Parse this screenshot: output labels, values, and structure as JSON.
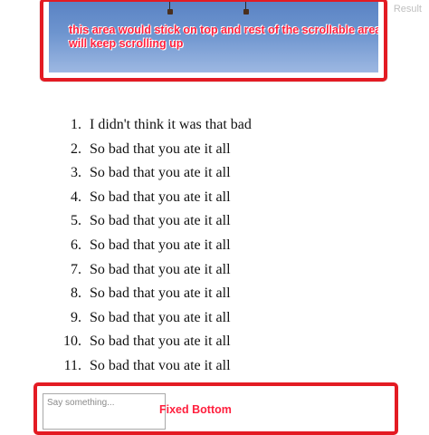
{
  "result_label": "Result",
  "header": {
    "annotation": "this area would stick on top and rest of the scrollable area will keep scrolling up"
  },
  "list": {
    "items": [
      {
        "number": "1.",
        "text": "I didn't think it was that bad"
      },
      {
        "number": "2.",
        "text": "So bad that you ate it all"
      },
      {
        "number": "3.",
        "text": "So bad that you ate it all"
      },
      {
        "number": "4.",
        "text": "So bad that you ate it all"
      },
      {
        "number": "5.",
        "text": "So bad that you ate it all"
      },
      {
        "number": "6.",
        "text": "So bad that you ate it all"
      },
      {
        "number": "7.",
        "text": "So bad that you ate it all"
      },
      {
        "number": "8.",
        "text": "So bad that you ate it all"
      },
      {
        "number": "9.",
        "text": "So bad that you ate it all"
      },
      {
        "number": "10.",
        "text": "So bad that you ate it all"
      },
      {
        "number": "11.",
        "text": "So bad that vou ate it all"
      }
    ]
  },
  "footer": {
    "input_placeholder": "Say something...",
    "annotation": "Fixed Bottom"
  },
  "colors": {
    "annotation_red": "#e31b23",
    "sky_blue": "#6e95cf"
  }
}
